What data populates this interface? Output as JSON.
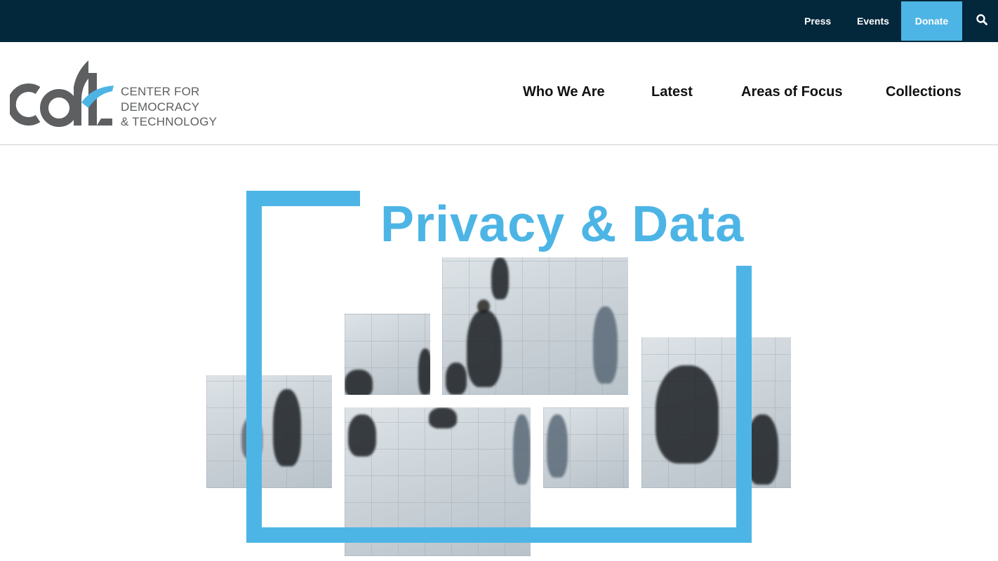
{
  "topbar": {
    "links": {
      "press": "Press",
      "events": "Events",
      "donate": "Donate"
    },
    "search_icon": "search-icon"
  },
  "logo": {
    "mark": "cdt",
    "lines": [
      "CENTER FOR",
      "DEMOCRACY",
      "& TECHNOLOGY"
    ]
  },
  "nav": {
    "who_we_are": "Who We Are",
    "latest": "Latest",
    "areas_of_focus": "Areas of Focus",
    "collections": "Collections"
  },
  "hero": {
    "title": "Privacy & Data",
    "image_alt": "crowd-walking-photo-collage"
  },
  "colors": {
    "topbar_bg": "#03273b",
    "accent": "#4db5e5",
    "logo_gray": "#5d5f61",
    "nav_text": "#111111"
  }
}
